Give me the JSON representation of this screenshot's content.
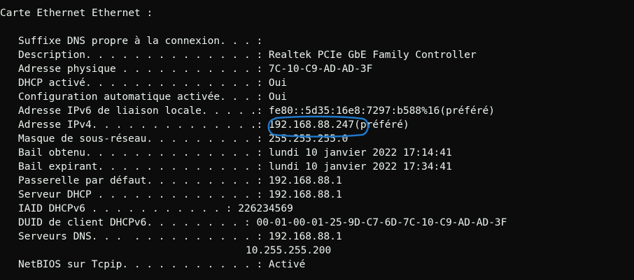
{
  "console": {
    "header": "Carte Ethernet Ethernet :",
    "rows": [
      "Suffixe DNS propre à la connexion. . . :",
      "Description. . . . . . . . . . . . . . : Realtek PCIe GbE Family Controller",
      "Adresse physique . . . . . . . . . . . : 7C-10-C9-AD-AD-3F",
      "DHCP activé. . . . . . . . . . . . . . : Oui",
      "Configuration automatique activée. . . : Oui",
      "Adresse IPv6 de liaison locale. . . . .: fe80::5d35:16e8:7297:b588%16(préféré)",
      "Adresse IPv4. . . . . . . . . . . . . .: 192.168.88.247(préféré)",
      "Masque de sous-réseau. . . . . . . . . : 255.255.255.0",
      "Bail obtenu. . . . . . . . . . . . . . : lundi 10 janvier 2022 17:14:41",
      "Bail expirant. . . . . . . . . . . . . : lundi 10 janvier 2022 17:34:41",
      "Passerelle par défaut. . . . . . . . . : 192.168.88.1",
      "Serveur DHCP . . . . . . . . . . . . . : 192.168.88.1",
      "IAID DHCPv6 . . . . . . . . . . . : 226234569",
      "DUID de client DHCPv6. . . . . . . . : 00-01-00-01-25-9D-C7-6D-7C-10-C9-AD-AD-3F",
      "Serveurs DNS. . .  . . . . . . . . . . : 192.168.88.1"
    ],
    "dns_continuation": "10.255.255.200",
    "netbios": "NetBIOS sur Tcpip. . . . . . . . . . . : Activé"
  },
  "colors": {
    "background": "#0c0c0c",
    "text": "#ecf4ee",
    "annotation": "#1f78c8"
  }
}
